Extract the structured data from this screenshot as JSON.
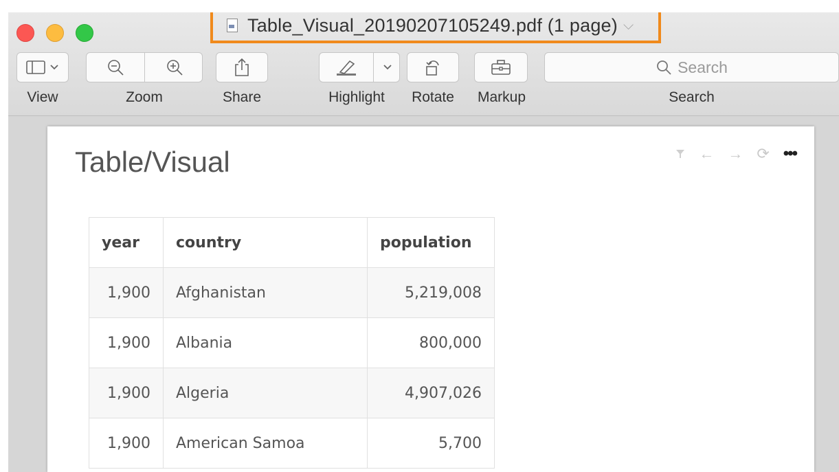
{
  "window": {
    "title": "Table_Visual_20190207105249.pdf (1 page)"
  },
  "toolbar": {
    "view_label": "View",
    "zoom_label": "Zoom",
    "share_label": "Share",
    "highlight_label": "Highlight",
    "rotate_label": "Rotate",
    "markup_label": "Markup",
    "search_label": "Search",
    "search_placeholder": "Search"
  },
  "document": {
    "visual_title": "Table/Visual",
    "table": {
      "headers": [
        "year",
        "country",
        "population"
      ],
      "rows": [
        [
          "1,900",
          "Afghanistan",
          "5,219,008"
        ],
        [
          "1,900",
          "Albania",
          "800,000"
        ],
        [
          "1,900",
          "Algeria",
          "4,907,026"
        ],
        [
          "1,900",
          "American Samoa",
          "5,700"
        ]
      ]
    }
  },
  "colors": {
    "highlight_border": "#f08a1c",
    "close": "#fc5753",
    "minimize": "#fdbc40",
    "zoom": "#33c748"
  }
}
